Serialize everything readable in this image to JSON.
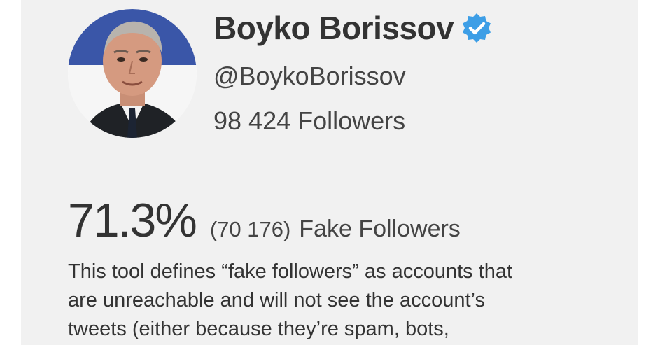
{
  "profile": {
    "name": "Boyko Borissov",
    "handle": "@BoykoBorissov",
    "followers": "98 424 Followers",
    "verified_icon": "verified-badge-icon",
    "verified_color": "#3d9ee6"
  },
  "result": {
    "percent": "71.3%",
    "count": "(70 176)",
    "label": "Fake Followers"
  },
  "description": {
    "line1": "This tool defines “fake followers” as accounts that",
    "line2": "are unreachable and will not see the account’s",
    "line3": "tweets (either because they’re spam, bots,"
  },
  "colors": {
    "card_background": "#f1f1f1",
    "text": "#333333"
  }
}
